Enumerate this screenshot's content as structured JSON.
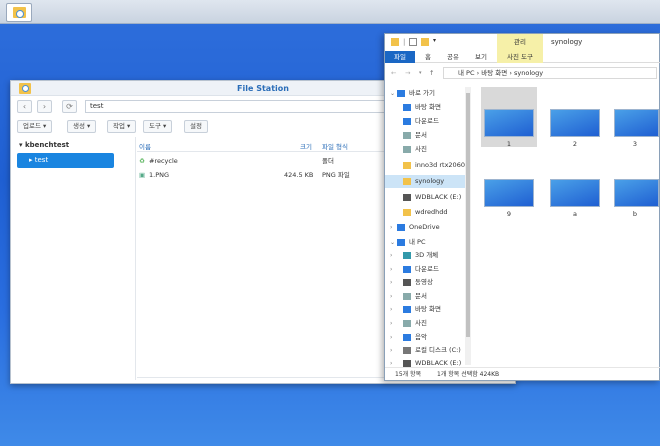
{
  "file_station": {
    "title": "File Station",
    "path": "test",
    "toolbar": [
      "업로드 ▾",
      "생성 ▾",
      "작업 ▾",
      "도구 ▾",
      "설정"
    ],
    "tree_root": "kbenchtest",
    "tree_selected": "test",
    "columns": {
      "name": "이름",
      "size": "크기",
      "type": "파일 형식"
    },
    "rows": [
      {
        "name": "#recycle",
        "size": "",
        "type": "폴더"
      },
      {
        "name": "1.PNG",
        "size": "424.5 KB",
        "type": "PNG 파일"
      }
    ]
  },
  "explorer": {
    "title": "synology",
    "manage_tab": "관리",
    "ribbon": {
      "file": "파일",
      "home": "홈",
      "share": "공유",
      "view": "보기",
      "picture_tools": "사진 도구"
    },
    "breadcrumb": [
      "내 PC",
      "바탕 화면",
      "synology"
    ],
    "nav": [
      {
        "label": "바로 가기",
        "arrow": "v"
      },
      {
        "label": "바탕 화면"
      },
      {
        "label": "다운로드"
      },
      {
        "label": "문서"
      },
      {
        "label": "사진"
      },
      {
        "label": "inno3d rtx2060"
      },
      {
        "label": "synology"
      },
      {
        "label": "WDBLACK (E:)"
      },
      {
        "label": "wdredhdd"
      },
      {
        "label": "OneDrive",
        "arrow": ">"
      },
      {
        "label": "내 PC",
        "arrow": "v"
      },
      {
        "label": "3D 개체",
        "arrow": ">"
      },
      {
        "label": "다운로드",
        "arrow": ">"
      },
      {
        "label": "동영상",
        "arrow": ">"
      },
      {
        "label": "문서",
        "arrow": ">"
      },
      {
        "label": "바탕 화면",
        "arrow": ">"
      },
      {
        "label": "사진",
        "arrow": ">"
      },
      {
        "label": "음악",
        "arrow": ">"
      },
      {
        "label": "로컬 디스크 (C:)",
        "arrow": ">"
      },
      {
        "label": "WDBLACK (E:)",
        "arrow": ">"
      }
    ],
    "thumbs": [
      "1",
      "2",
      "3",
      "9",
      "a",
      "b"
    ],
    "status_count": "15개 항목",
    "status_selected": "1개 항목 선택함 424KB"
  },
  "colors": {
    "accent": "#1a85e0",
    "ribbon_file": "#1a67c4",
    "manage_bg": "#f6f0a8"
  }
}
